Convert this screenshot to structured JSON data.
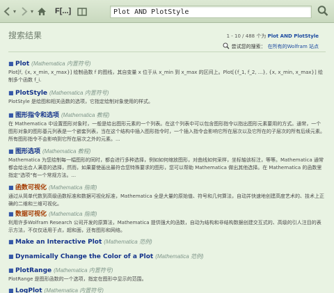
{
  "toolbar": {
    "breadcrumb": "F[...]",
    "search_value": "Plot AND PlotStyle",
    "back_dropdown": "▾",
    "fwd_dropdown": "▾"
  },
  "header": {
    "title": "搜索结果",
    "count_prefix": "1 - 10 / 488 个为",
    "count_query": "Plot AND PlotStyle",
    "also_label": "尝试您的搜索：",
    "also_link": "在所有的Wolfram 站点"
  },
  "results": [
    {
      "name": "Plot",
      "type": "(Mathematica 内置符号)",
      "desc": "Plot[f, {x, x_min, x_max}] 绘制函数 f 的图线，其自变量 x 位于从 x_min 到 x_max 的区间上。Plot[{f_1, f_2, ...}, {x, x_min, x_max}] 绘制多个函数 f_i."
    },
    {
      "name": "PlotStyle",
      "type": "(Mathematica 内置符号)",
      "desc": "PlotStyle 是绘图和相关函数的选项，它指定绘制对象使用的样式。"
    },
    {
      "name": "图形指令和选项",
      "type": "(Mathematica 教程)",
      "desc": "在 Mathematica 中设置图形对象时，一般是给出图形元素的一个列表。在这个列表中可以包含图形指令以指出图形元素要用的方式。通常，一个图形对象的图形基元列表是一个嵌套列表，当在这个结构中插入图形指令时，一个插入指令会影响它所在层次以及它所在的子层次的所有后续元素。所有图形指令不会影响到它所在层次之外的元素。..."
    },
    {
      "name": "图形选项",
      "type": "(Mathematica 教程)",
      "desc": "Mathematica 为您绘制每一幅图形的同时，都会进行多种选择，例如如何缩放图形，对曲线如何采样，坐标轴该标注，等等。Mathematica 通常都会给出合人满意的选择，然而，如果要使画出最符合您特殊要求的图形，您可以帮助 Mathematica 做出其他选择。在 Mathematica 的函数里指定\"选项\"有一个常规方法。..."
    },
    {
      "name": "函数可视化",
      "type": "(Mathematica 指南)",
      "desc": "通过从简单代数到高级函数标准和数据可视化标准，Mathematica 全是大量的原始值、符号和几何算法，自动并快速地创建高度艺术的、技术上正确的二维和三维可视化。"
    },
    {
      "name": "数据可视化",
      "type": "(Mathematica 指南)",
      "desc": "利用许多Wolfram Research 公司开发的原算法，Mathematica 提供强大的函数，自动为结构和非结构数据创建交互式的、高级的引人注目的表示方法，不仅仅适用于点，超和面，还有图形和网络。"
    },
    {
      "name": "Make an Interactive Plot",
      "type": "(Mathematica 范例)",
      "desc": ""
    },
    {
      "name": "Dynamically Change the Color of a Plot",
      "type": "(Mathematica 范例)",
      "desc": ""
    },
    {
      "name": "PlotRange",
      "type": "(Mathematica 内置符号)",
      "desc": "PlotRange 是图形函数的一个选项，指定在图形中显示的范围。"
    },
    {
      "name": "LogPlot",
      "type": "(Mathematica 内置符号)",
      "desc": ""
    }
  ]
}
